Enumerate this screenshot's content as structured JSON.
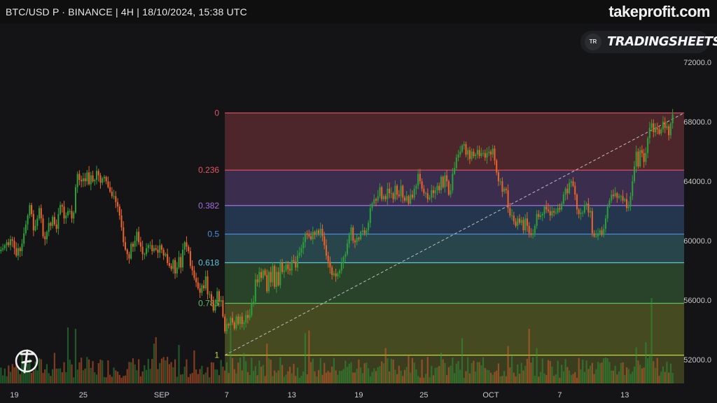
{
  "header": {
    "title": "BTC/USD P · BINANCE | 4H | 18/10/2024, 15:38 UTC",
    "brand": "takeprofit.com"
  },
  "badge": {
    "icon_text": "TR",
    "name": "TRADINGSHEETS"
  },
  "logo": {
    "icon": "takeprofit-logo-icon"
  },
  "colors": {
    "up": "#2e9e3a",
    "down": "#e8632a",
    "background": "#141416"
  },
  "chart_data": {
    "type": "candlestick",
    "y_axis": {
      "ticks": [
        52000.0,
        56000.0,
        60000.0,
        64000.0,
        68000.0,
        72000.0
      ],
      "tick_labels": [
        "52000.0",
        "56000.0",
        "60000.0",
        "64000.0",
        "68000.0",
        "72000.0"
      ],
      "ylim": [
        50400,
        74600
      ],
      "position": "right"
    },
    "x_axis": {
      "ticks": [
        {
          "label": "19",
          "i": 7
        },
        {
          "label": "25",
          "i": 43
        },
        {
          "label": "SEP",
          "i": 84
        },
        {
          "label": "7",
          "i": 118
        },
        {
          "label": "13",
          "i": 152
        },
        {
          "label": "19",
          "i": 187
        },
        {
          "label": "25",
          "i": 221
        },
        {
          "label": "OCT",
          "i": 256
        },
        {
          "label": "7",
          "i": 292
        },
        {
          "label": "13",
          "i": 326
        }
      ]
    },
    "fibonacci": {
      "start_index": 117,
      "end_index": 357,
      "high": 68600,
      "low": 52300,
      "levels": [
        {
          "ratio": 0,
          "label": "0",
          "price": 68600,
          "color": "#e05563"
        },
        {
          "ratio": 0.236,
          "label": "0.236",
          "price": 64750,
          "color": "#e05563"
        },
        {
          "ratio": 0.382,
          "label": "0.382",
          "price": 62370,
          "color": "#a36ee0"
        },
        {
          "ratio": 0.5,
          "label": "0.5",
          "price": 60450,
          "color": "#4a8fe0"
        },
        {
          "ratio": 0.618,
          "label": "0.618",
          "price": 58520,
          "color": "#5cc5d8"
        },
        {
          "ratio": 0.786,
          "label": "0.786",
          "price": 55790,
          "color": "#5fbf5f"
        },
        {
          "ratio": 1,
          "label": "1",
          "price": 52300,
          "color": "#c6d640"
        }
      ]
    },
    "close_series": [
      59400,
      59500,
      59700,
      59900,
      59700,
      60100,
      60000,
      59500,
      59000,
      59500,
      59300,
      59800,
      60500,
      61100,
      61700,
      62400,
      61800,
      60700,
      61000,
      61500,
      62200,
      61500,
      60300,
      60100,
      60600,
      61200,
      61000,
      61600,
      61100,
      60800,
      61800,
      62400,
      62300,
      61500,
      61700,
      62000,
      62000,
      61500,
      61900,
      63600,
      64500,
      64100,
      64000,
      64200,
      64000,
      64600,
      63800,
      64400,
      64000,
      64100,
      64700,
      64400,
      63900,
      64200,
      64300,
      64000,
      63600,
      63300,
      63000,
      63000,
      62600,
      62300,
      61700,
      60900,
      59900,
      59400,
      59100,
      58800,
      59800,
      59600,
      60000,
      60600,
      59900,
      59600,
      59100,
      59100,
      59500,
      59700,
      59700,
      59300,
      59500,
      59400,
      59200,
      59700,
      59400,
      59000,
      59100,
      58500,
      58300,
      58100,
      58700,
      57800,
      58200,
      58900,
      58200,
      59400,
      59900,
      59600,
      59300,
      58300,
      58000,
      57500,
      57200,
      56800,
      56500,
      57000,
      56800,
      57600,
      56400,
      56400,
      56000,
      55300,
      55700,
      56600,
      55900,
      56000,
      54900,
      53900,
      54400,
      54300,
      54800,
      54500,
      54100,
      54900,
      54400,
      54900,
      54400,
      54500,
      55000,
      54800,
      55000,
      55800,
      55900,
      57400,
      57200,
      57900,
      57500,
      58000,
      57700,
      56600,
      57900,
      57200,
      58300,
      56900,
      57900,
      57000,
      58500,
      57900,
      58000,
      58400,
      58100,
      58000,
      58700,
      58600,
      58200,
      59000,
      59200,
      59500,
      59900,
      60500,
      60400,
      60300,
      60100,
      60600,
      60400,
      60700,
      60500,
      60800,
      60300,
      59700,
      59000,
      58600,
      58200,
      57700,
      57800,
      57600,
      57800,
      58000,
      58500,
      58900,
      59100,
      59800,
      60400,
      60900,
      60000,
      59900,
      60200,
      60100,
      60600,
      60700,
      60500,
      60700,
      61200,
      62200,
      62500,
      62800,
      62700,
      63000,
      63600,
      62800,
      63000,
      62800,
      63500,
      63200,
      63200,
      62800,
      63700,
      63100,
      63000,
      63700,
      62900,
      62700,
      63000,
      62500,
      63100,
      62900,
      63500,
      63700,
      64500,
      64000,
      63500,
      63200,
      63200,
      62800,
      62900,
      63400,
      63200,
      63400,
      63700,
      63400,
      64300,
      63600,
      64400,
      64000,
      63100,
      63400,
      64500,
      64900,
      65600,
      65800,
      66000,
      66400,
      66500,
      65800,
      66100,
      65500,
      66000,
      65700,
      65800,
      66100,
      65700,
      65900,
      65900,
      65600,
      65900,
      66000,
      65800,
      66200,
      65400,
      64600,
      64000,
      64000,
      63300,
      63500,
      63400,
      62200,
      61700,
      61700,
      61300,
      61000,
      61500,
      61200,
      61400,
      60700,
      61500,
      61000,
      60500,
      60400,
      60500,
      61000,
      61800,
      61600,
      61700,
      61800,
      62300,
      62100,
      62000,
      61700,
      62000,
      61900,
      61900,
      62200,
      62100,
      62500,
      63100,
      63500,
      63200,
      63900,
      64000,
      63700,
      63100,
      62100,
      61800,
      61900,
      61900,
      62400,
      62500,
      61900,
      62000,
      60500,
      60300,
      60300,
      60500,
      60700,
      60400,
      60800,
      61500,
      62300,
      62700,
      63100,
      63000,
      63200,
      62900,
      63000,
      63000,
      62700,
      62800,
      62200,
      62300,
      63000,
      64000,
      65000,
      66000,
      65000,
      66100,
      65900,
      65300,
      65900,
      66900,
      67600,
      67900,
      67300,
      67600,
      67500,
      67200,
      67500,
      68000,
      67600,
      67700,
      67100,
      67900,
      68500
    ]
  }
}
